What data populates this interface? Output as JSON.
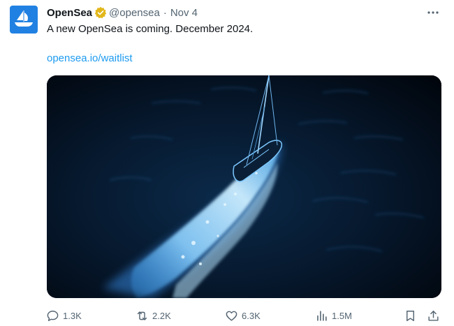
{
  "tweet": {
    "author_name": "OpenSea",
    "handle": "@opensea",
    "separator": "·",
    "date": "Nov 4",
    "text": "A new OpenSea is coming. December 2024.",
    "link_text": "opensea.io/waitlist",
    "avatar_icon": "opensea-logo-icon",
    "brand_color": "#2081e2",
    "verified_color": "#e2b719",
    "link_color": "#1d9bf0"
  },
  "actions": {
    "replies": "1.3K",
    "reposts": "2.2K",
    "likes": "6.3K",
    "views": "1.5M"
  }
}
